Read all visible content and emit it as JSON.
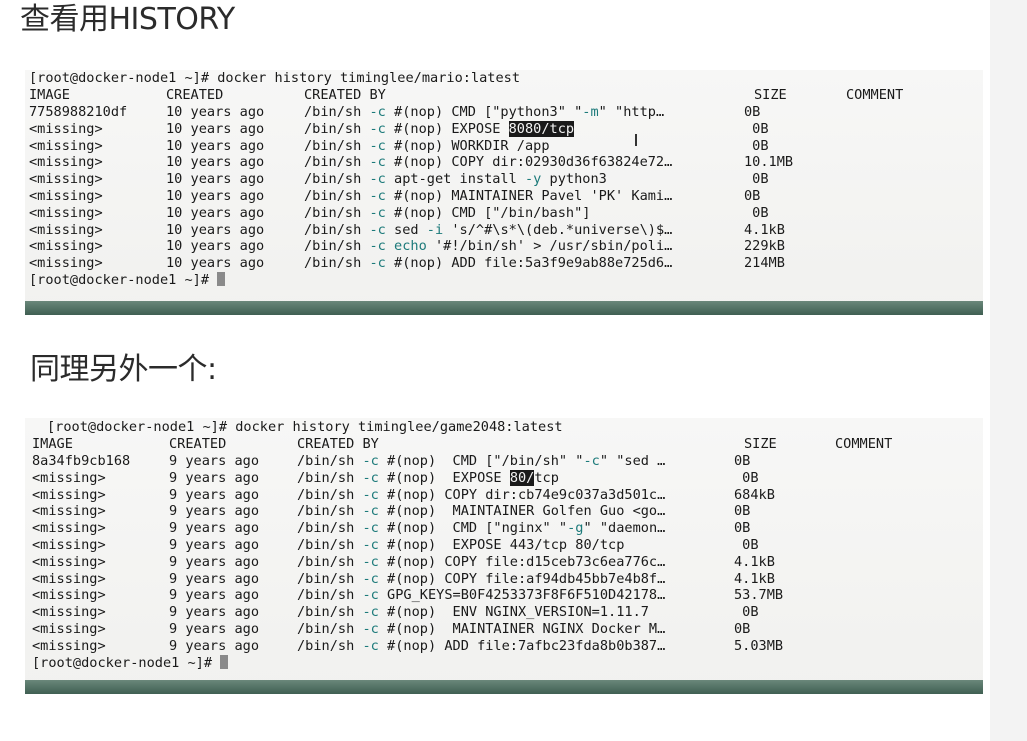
{
  "heading_1": "查看用HISTORY",
  "heading_2": "同理另外一个:",
  "term1": {
    "prompt": "[root@docker-node1 ~]# docker history timinglee/mario:latest",
    "headers": {
      "image": "IMAGE",
      "created": "CREATED",
      "created_by": "CREATED BY",
      "size": "SIZE",
      "comment": "COMMENT"
    },
    "rows": [
      {
        "image": "7758988210df",
        "created": "10 years ago",
        "sh": "/bin/sh ",
        "opt": "-c",
        "rest": " #(nop) CMD [\"python3\" \"",
        "opt2": "-m",
        "rest2": "\" \"http…",
        "size": "0B"
      },
      {
        "image": "<missing>",
        "created": "10 years ago",
        "sh": "/bin/sh ",
        "opt": "-c",
        "rest": " #(nop) EXPOSE ",
        "hl": "8080/tcp",
        "rest2": "",
        "size": " 0B"
      },
      {
        "image": "<missing>",
        "created": "10 years ago",
        "sh": "/bin/sh ",
        "opt": "-c",
        "rest": " #(nop) WORKDIR /app",
        "size": " 0B"
      },
      {
        "image": "<missing>",
        "created": "10 years ago",
        "sh": "/bin/sh ",
        "opt": "-c",
        "rest": " #(nop) COPY dir:02930d36f63824e72…",
        "size": "10.1MB"
      },
      {
        "image": "<missing>",
        "created": "10 years ago",
        "sh": "/bin/sh ",
        "opt": "-c",
        "rest": " apt-get install ",
        "opt2": "-y",
        "rest2": " python3",
        "size": " 0B"
      },
      {
        "image": "<missing>",
        "created": "10 years ago",
        "sh": "/bin/sh ",
        "opt": "-c",
        "rest": " #(nop) MAINTAINER Pavel 'PK' Kami…",
        "size": "0B"
      },
      {
        "image": "<missing>",
        "created": "10 years ago",
        "sh": "/bin/sh ",
        "opt": "-c",
        "rest": " #(nop) CMD [\"/bin/bash\"]",
        "size": " 0B"
      },
      {
        "image": "<missing>",
        "created": "10 years ago",
        "sh": "/bin/sh ",
        "opt": "-c",
        "rest": " sed ",
        "opt2": "-i",
        "rest2": " 's/^#\\s*\\(deb.*universe\\)$…",
        "size": "4.1kB"
      },
      {
        "image": "<missing>",
        "created": "10 years ago",
        "sh": "/bin/sh ",
        "opt": "-c",
        "rest": " ",
        "echo": "echo",
        "rest2": " '#!/bin/sh' > /usr/sbin/poli…",
        "size": "229kB"
      },
      {
        "image": "<missing>",
        "created": "10 years ago",
        "sh": "/bin/sh ",
        "opt": "-c",
        "rest": " #(nop) ADD file:5a3f9e9ab88e725d6…",
        "size": "214MB"
      }
    ],
    "end_prompt": "[root@docker-node1 ~]# "
  },
  "term2": {
    "prompt": "[root@docker-node1 ~]# docker history timinglee/game2048:latest",
    "headers": {
      "image": "IMAGE",
      "created": "CREATED",
      "created_by": "CREATED BY",
      "size": "SIZE",
      "comment": "COMMENT"
    },
    "rows": [
      {
        "image": "8a34fb9cb168",
        "created": "9 years ago",
        "sh": "/bin/sh ",
        "opt": "-c",
        "rest": " #(nop)  CMD [\"/bin/sh\" \"",
        "opt2": "-c",
        "rest2": "\" \"sed …",
        "size": "0B"
      },
      {
        "image": "<missing>",
        "created": "9 years ago",
        "sh": "/bin/sh ",
        "opt": "-c",
        "rest": " #(nop)  EXPOSE ",
        "hl": "80/",
        "rest2": "tcp",
        "size": " 0B"
      },
      {
        "image": "<missing>",
        "created": "9 years ago",
        "sh": "/bin/sh ",
        "opt": "-c",
        "rest": " #(nop) COPY dir:cb74e9c037a3d501c…",
        "size": "684kB"
      },
      {
        "image": "<missing>",
        "created": "9 years ago",
        "sh": "/bin/sh ",
        "opt": "-c",
        "rest": " #(nop)  MAINTAINER Golfen Guo <go…",
        "size": "0B"
      },
      {
        "image": "<missing>",
        "created": "9 years ago",
        "sh": "/bin/sh ",
        "opt": "-c",
        "rest": " #(nop)  CMD [\"nginx\" \"",
        "opt2": "-g",
        "rest2": "\" \"daemon…",
        "size": "0B"
      },
      {
        "image": "<missing>",
        "created": "9 years ago",
        "sh": "/bin/sh ",
        "opt": "-c",
        "rest": " #(nop)  EXPOSE 443/tcp 80/tcp",
        "size": " 0B"
      },
      {
        "image": "<missing>",
        "created": "9 years ago",
        "sh": "/bin/sh ",
        "opt": "-c",
        "rest": " #(nop) COPY file:d15ceb73c6ea776c…",
        "size": "4.1kB"
      },
      {
        "image": "<missing>",
        "created": "9 years ago",
        "sh": "/bin/sh ",
        "opt": "-c",
        "rest": " #(nop) COPY file:af94db45bb7e4b8f…",
        "size": "4.1kB"
      },
      {
        "image": "<missing>",
        "created": "9 years ago",
        "sh": "/bin/sh ",
        "opt": "-c",
        "rest": " GPG_KEYS=B0F4253373F8F6F510D42178…",
        "size": "53.7MB"
      },
      {
        "image": "<missing>",
        "created": "9 years ago",
        "sh": "/bin/sh ",
        "opt": "-c",
        "rest": " #(nop)  ENV NGINX_VERSION=1.11.7",
        "size": " 0B"
      },
      {
        "image": "<missing>",
        "created": "9 years ago",
        "sh": "/bin/sh ",
        "opt": "-c",
        "rest": " #(nop)  MAINTAINER NGINX Docker M…",
        "size": "0B"
      },
      {
        "image": "<missing>",
        "created": "9 years ago",
        "sh": "/bin/sh ",
        "opt": "-c",
        "rest": " #(nop) ADD file:7afbc23fda8b0b387…",
        "size": "5.03MB"
      }
    ],
    "end_prompt": "[root@docker-node1 ~]# "
  },
  "colors": {
    "option": "#1c7a7a",
    "terminal_bar": "#3f5f52",
    "highlight_bg": "#1a1a1a"
  }
}
